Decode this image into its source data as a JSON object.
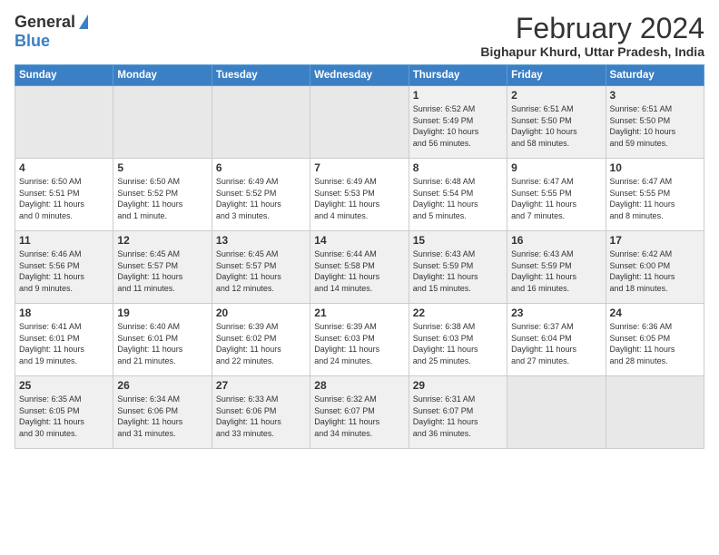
{
  "header": {
    "logo_general": "General",
    "logo_blue": "Blue",
    "title": "February 2024",
    "subtitle": "Bighapur Khurd, Uttar Pradesh, India"
  },
  "weekdays": [
    "Sunday",
    "Monday",
    "Tuesday",
    "Wednesday",
    "Thursday",
    "Friday",
    "Saturday"
  ],
  "rows": [
    [
      {
        "day": "",
        "info": ""
      },
      {
        "day": "",
        "info": ""
      },
      {
        "day": "",
        "info": ""
      },
      {
        "day": "",
        "info": ""
      },
      {
        "day": "1",
        "info": "Sunrise: 6:52 AM\nSunset: 5:49 PM\nDaylight: 10 hours\nand 56 minutes."
      },
      {
        "day": "2",
        "info": "Sunrise: 6:51 AM\nSunset: 5:50 PM\nDaylight: 10 hours\nand 58 minutes."
      },
      {
        "day": "3",
        "info": "Sunrise: 6:51 AM\nSunset: 5:50 PM\nDaylight: 10 hours\nand 59 minutes."
      }
    ],
    [
      {
        "day": "4",
        "info": "Sunrise: 6:50 AM\nSunset: 5:51 PM\nDaylight: 11 hours\nand 0 minutes."
      },
      {
        "day": "5",
        "info": "Sunrise: 6:50 AM\nSunset: 5:52 PM\nDaylight: 11 hours\nand 1 minute."
      },
      {
        "day": "6",
        "info": "Sunrise: 6:49 AM\nSunset: 5:52 PM\nDaylight: 11 hours\nand 3 minutes."
      },
      {
        "day": "7",
        "info": "Sunrise: 6:49 AM\nSunset: 5:53 PM\nDaylight: 11 hours\nand 4 minutes."
      },
      {
        "day": "8",
        "info": "Sunrise: 6:48 AM\nSunset: 5:54 PM\nDaylight: 11 hours\nand 5 minutes."
      },
      {
        "day": "9",
        "info": "Sunrise: 6:47 AM\nSunset: 5:55 PM\nDaylight: 11 hours\nand 7 minutes."
      },
      {
        "day": "10",
        "info": "Sunrise: 6:47 AM\nSunset: 5:55 PM\nDaylight: 11 hours\nand 8 minutes."
      }
    ],
    [
      {
        "day": "11",
        "info": "Sunrise: 6:46 AM\nSunset: 5:56 PM\nDaylight: 11 hours\nand 9 minutes."
      },
      {
        "day": "12",
        "info": "Sunrise: 6:45 AM\nSunset: 5:57 PM\nDaylight: 11 hours\nand 11 minutes."
      },
      {
        "day": "13",
        "info": "Sunrise: 6:45 AM\nSunset: 5:57 PM\nDaylight: 11 hours\nand 12 minutes."
      },
      {
        "day": "14",
        "info": "Sunrise: 6:44 AM\nSunset: 5:58 PM\nDaylight: 11 hours\nand 14 minutes."
      },
      {
        "day": "15",
        "info": "Sunrise: 6:43 AM\nSunset: 5:59 PM\nDaylight: 11 hours\nand 15 minutes."
      },
      {
        "day": "16",
        "info": "Sunrise: 6:43 AM\nSunset: 5:59 PM\nDaylight: 11 hours\nand 16 minutes."
      },
      {
        "day": "17",
        "info": "Sunrise: 6:42 AM\nSunset: 6:00 PM\nDaylight: 11 hours\nand 18 minutes."
      }
    ],
    [
      {
        "day": "18",
        "info": "Sunrise: 6:41 AM\nSunset: 6:01 PM\nDaylight: 11 hours\nand 19 minutes."
      },
      {
        "day": "19",
        "info": "Sunrise: 6:40 AM\nSunset: 6:01 PM\nDaylight: 11 hours\nand 21 minutes."
      },
      {
        "day": "20",
        "info": "Sunrise: 6:39 AM\nSunset: 6:02 PM\nDaylight: 11 hours\nand 22 minutes."
      },
      {
        "day": "21",
        "info": "Sunrise: 6:39 AM\nSunset: 6:03 PM\nDaylight: 11 hours\nand 24 minutes."
      },
      {
        "day": "22",
        "info": "Sunrise: 6:38 AM\nSunset: 6:03 PM\nDaylight: 11 hours\nand 25 minutes."
      },
      {
        "day": "23",
        "info": "Sunrise: 6:37 AM\nSunset: 6:04 PM\nDaylight: 11 hours\nand 27 minutes."
      },
      {
        "day": "24",
        "info": "Sunrise: 6:36 AM\nSunset: 6:05 PM\nDaylight: 11 hours\nand 28 minutes."
      }
    ],
    [
      {
        "day": "25",
        "info": "Sunrise: 6:35 AM\nSunset: 6:05 PM\nDaylight: 11 hours\nand 30 minutes."
      },
      {
        "day": "26",
        "info": "Sunrise: 6:34 AM\nSunset: 6:06 PM\nDaylight: 11 hours\nand 31 minutes."
      },
      {
        "day": "27",
        "info": "Sunrise: 6:33 AM\nSunset: 6:06 PM\nDaylight: 11 hours\nand 33 minutes."
      },
      {
        "day": "28",
        "info": "Sunrise: 6:32 AM\nSunset: 6:07 PM\nDaylight: 11 hours\nand 34 minutes."
      },
      {
        "day": "29",
        "info": "Sunrise: 6:31 AM\nSunset: 6:07 PM\nDaylight: 11 hours\nand 36 minutes."
      },
      {
        "day": "",
        "info": ""
      },
      {
        "day": "",
        "info": ""
      }
    ]
  ]
}
